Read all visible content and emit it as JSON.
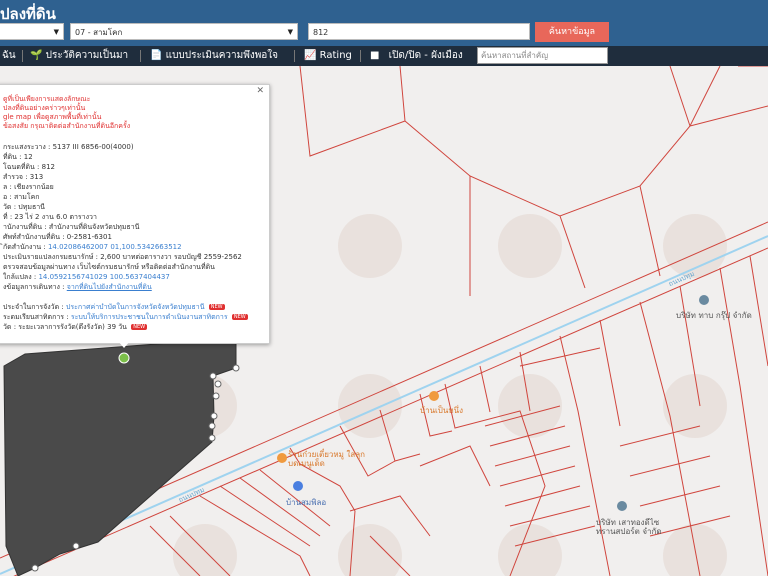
{
  "header": {
    "title": "ปลงที่ดิน",
    "district_value": "07 - สามโคก",
    "parcel_value": "812",
    "search_button": "ค้นหาข้อมูล"
  },
  "toolbar": {
    "items": [
      "ฉัน",
      "ประวัติความเป็นมา",
      "แบบประเมินความพึงพอใจ",
      "Rating",
      "เปิด/ปิด - ผังเมือง"
    ],
    "search_placeholder": "ค้นหาสถานที่สำคัญ"
  },
  "popup": {
    "notice": [
      "ดูที่เป็นเพียงการแสดงลักษณะ",
      "ปลงที่ดินอย่างคร่าวๆเท่านั้น",
      "gle map เพื่อดูสภาพพื้นที่เท่านั้น",
      "ข้อสงสัย กรุณาติดต่อสำนักงานที่ดินอีกครั้ง"
    ],
    "fields": [
      "กระแสงระวาง : 5137 III 6856-00(4000)",
      "ที่ดิน : 12",
      "โฉนดที่ดิน : 812",
      "สำรวจ : 313",
      "ล : เชียงรากน้อย",
      "อ : สามโคก",
      "วัด : ปทุมธานี",
      "ที่ : 23 ไร่ 2 งาน 6.0 ตารางวา",
      "านักงานที่ดิน : สำนักงานที่ดินจังหวัดปทุมธานี",
      "ศัพท์สำนักงานที่ดิน : 0-2581-6301"
    ],
    "coord_office": "14.02086462007 01,100.5342663512",
    "assessment": "ประเมินรายแปลงกรมธนารักษ์ : 2,600 บาทต่อตารางวา รอบบัญชี 2559-2562",
    "check_link": "ตรวจสอบข้อมูลผ่านทาง เว็บไซต์กรมธนารักษ์ หรือติดต่อสำนักงานที่ดิน",
    "parcel_coord": "14.0592156741029 100.5637404437",
    "parcel_coord_label": "ใกล้แปลง :",
    "travel_link": "จากที่ดินไปยังสำนักงานที่ดิน",
    "travel_label": "งข้อมูลการเดินทาง :",
    "links": [
      {
        "label": "ประจำในการจังวัด :",
        "value": "ประกาศค่าบำบัดในการจังหวัดจังหวัดปทุมธานี",
        "tag": "NEW"
      },
      {
        "label": "ระดมเรียนสาทิตการ :",
        "value": "ระบบให้บริการประชาชนในการดำเนินงานสาทิตการ",
        "tag": "NEW"
      },
      {
        "label": "วัด :",
        "value": "ระยะเวลาการรังวัด(ตึงรังวัด) 39 วัน",
        "tag": "NEW"
      }
    ]
  },
  "map": {
    "places": [
      "บ้านเป็นหนึ่ง",
      "ร้านก๋วยเตี๋ยวหมู ใส่ลูกบดเมนูเด็ด",
      "บ้านสมพิลอ",
      "บริษัท ทาบ กรุ๊ป จำกัด",
      "บริษัท เสาทองดีไซ ทรานสปอร์ต จำกัด"
    ],
    "road": "ถนนปทุม",
    "colors": {
      "parcel_fill": "#4a4a4a",
      "parcel_lines": "#d0453d",
      "road": "#9fd3ef",
      "header": "#2f6190",
      "toolbar": "#1f2d3d",
      "button": "#e8675a"
    }
  }
}
